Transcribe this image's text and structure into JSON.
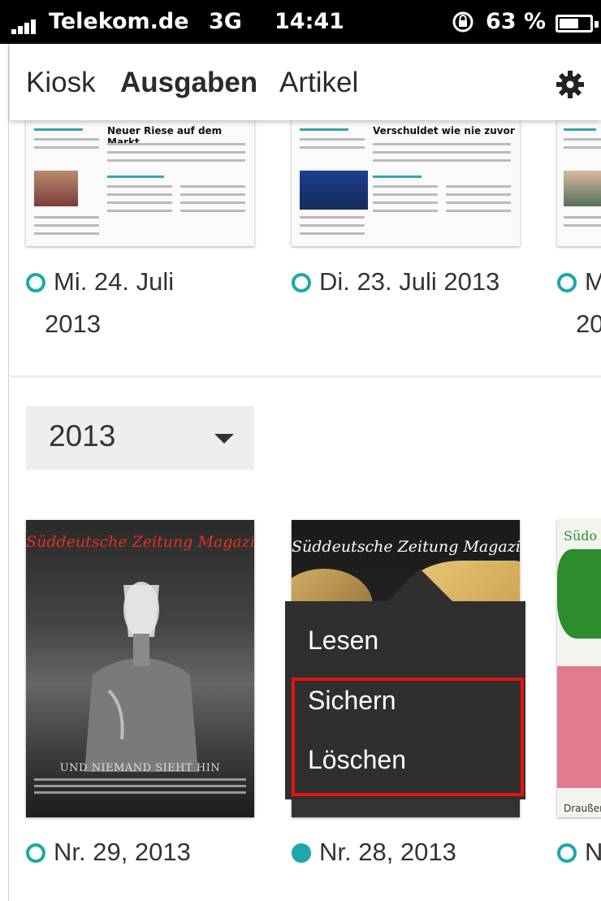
{
  "status_bar": {
    "carrier": "Telekom.de",
    "network": "3G",
    "time": "14:41",
    "battery_percent": "63 %",
    "battery_level": 0.63
  },
  "header": {
    "tabs": [
      {
        "label": "Kiosk",
        "active": false
      },
      {
        "label": "Ausgaben",
        "active": true
      },
      {
        "label": "Artikel",
        "active": false
      }
    ],
    "settings_icon": "gear-icon"
  },
  "newspapers": [
    {
      "headline": "Neuer Riese auf dem Markt",
      "date_line1": "Mi. 24. Juli",
      "date_line2": "2013",
      "downloaded": false
    },
    {
      "headline": "Verschuldet wie nie zuvor",
      "date_line1": "Di. 23. Juli 2013",
      "date_line2": "",
      "downloaded": false
    },
    {
      "headline": "",
      "date_line1": "M",
      "date_line2": "20",
      "downloaded": false
    }
  ],
  "year_select": {
    "value": "2013"
  },
  "magazines": [
    {
      "masthead": "Süddeutsche Zeitung Magazin",
      "tagline": "UND NIEMAND SIEHT HIN",
      "label": "Nr. 29, 2013",
      "downloaded": false
    },
    {
      "masthead": "Süddeutsche Zeitung Magazin",
      "tagline": "",
      "label": "Nr. 28, 2013",
      "downloaded": true
    },
    {
      "masthead": "Südo",
      "tagline": "Draußen s",
      "label": "N",
      "downloaded": false
    }
  ],
  "context_menu": {
    "items": [
      "Lesen",
      "Sichern",
      "Löschen"
    ],
    "highlighted": [
      "Sichern",
      "Löschen"
    ]
  },
  "colors": {
    "accent": "#1fa7a9",
    "highlight_border": "#e3130f",
    "menu_background": "#2f2f2f"
  }
}
